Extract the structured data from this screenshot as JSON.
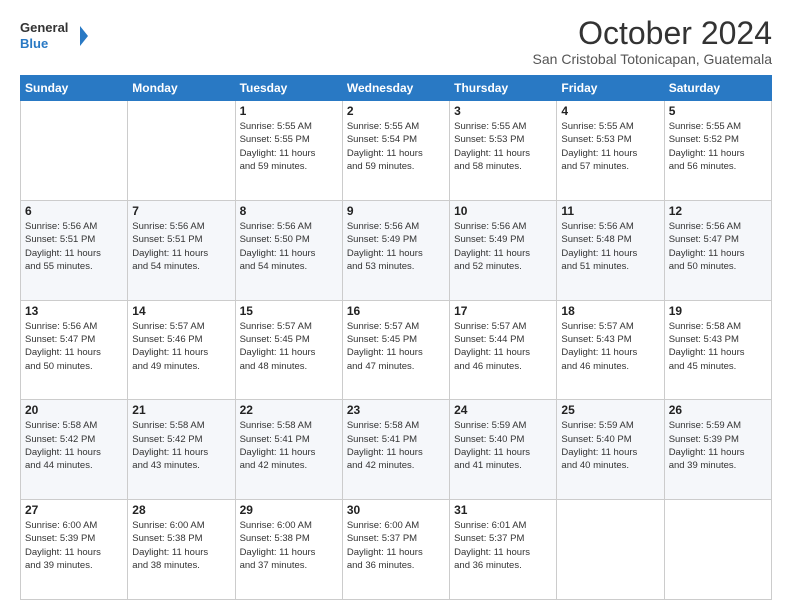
{
  "logo": {
    "line1": "General",
    "line2": "Blue"
  },
  "header": {
    "month": "October 2024",
    "location": "San Cristobal Totonicapan, Guatemala"
  },
  "weekdays": [
    "Sunday",
    "Monday",
    "Tuesday",
    "Wednesday",
    "Thursday",
    "Friday",
    "Saturday"
  ],
  "weeks": [
    [
      {
        "day": "",
        "info": ""
      },
      {
        "day": "",
        "info": ""
      },
      {
        "day": "1",
        "info": "Sunrise: 5:55 AM\nSunset: 5:55 PM\nDaylight: 11 hours\nand 59 minutes."
      },
      {
        "day": "2",
        "info": "Sunrise: 5:55 AM\nSunset: 5:54 PM\nDaylight: 11 hours\nand 59 minutes."
      },
      {
        "day": "3",
        "info": "Sunrise: 5:55 AM\nSunset: 5:53 PM\nDaylight: 11 hours\nand 58 minutes."
      },
      {
        "day": "4",
        "info": "Sunrise: 5:55 AM\nSunset: 5:53 PM\nDaylight: 11 hours\nand 57 minutes."
      },
      {
        "day": "5",
        "info": "Sunrise: 5:55 AM\nSunset: 5:52 PM\nDaylight: 11 hours\nand 56 minutes."
      }
    ],
    [
      {
        "day": "6",
        "info": "Sunrise: 5:56 AM\nSunset: 5:51 PM\nDaylight: 11 hours\nand 55 minutes."
      },
      {
        "day": "7",
        "info": "Sunrise: 5:56 AM\nSunset: 5:51 PM\nDaylight: 11 hours\nand 54 minutes."
      },
      {
        "day": "8",
        "info": "Sunrise: 5:56 AM\nSunset: 5:50 PM\nDaylight: 11 hours\nand 54 minutes."
      },
      {
        "day": "9",
        "info": "Sunrise: 5:56 AM\nSunset: 5:49 PM\nDaylight: 11 hours\nand 53 minutes."
      },
      {
        "day": "10",
        "info": "Sunrise: 5:56 AM\nSunset: 5:49 PM\nDaylight: 11 hours\nand 52 minutes."
      },
      {
        "day": "11",
        "info": "Sunrise: 5:56 AM\nSunset: 5:48 PM\nDaylight: 11 hours\nand 51 minutes."
      },
      {
        "day": "12",
        "info": "Sunrise: 5:56 AM\nSunset: 5:47 PM\nDaylight: 11 hours\nand 50 minutes."
      }
    ],
    [
      {
        "day": "13",
        "info": "Sunrise: 5:56 AM\nSunset: 5:47 PM\nDaylight: 11 hours\nand 50 minutes."
      },
      {
        "day": "14",
        "info": "Sunrise: 5:57 AM\nSunset: 5:46 PM\nDaylight: 11 hours\nand 49 minutes."
      },
      {
        "day": "15",
        "info": "Sunrise: 5:57 AM\nSunset: 5:45 PM\nDaylight: 11 hours\nand 48 minutes."
      },
      {
        "day": "16",
        "info": "Sunrise: 5:57 AM\nSunset: 5:45 PM\nDaylight: 11 hours\nand 47 minutes."
      },
      {
        "day": "17",
        "info": "Sunrise: 5:57 AM\nSunset: 5:44 PM\nDaylight: 11 hours\nand 46 minutes."
      },
      {
        "day": "18",
        "info": "Sunrise: 5:57 AM\nSunset: 5:43 PM\nDaylight: 11 hours\nand 46 minutes."
      },
      {
        "day": "19",
        "info": "Sunrise: 5:58 AM\nSunset: 5:43 PM\nDaylight: 11 hours\nand 45 minutes."
      }
    ],
    [
      {
        "day": "20",
        "info": "Sunrise: 5:58 AM\nSunset: 5:42 PM\nDaylight: 11 hours\nand 44 minutes."
      },
      {
        "day": "21",
        "info": "Sunrise: 5:58 AM\nSunset: 5:42 PM\nDaylight: 11 hours\nand 43 minutes."
      },
      {
        "day": "22",
        "info": "Sunrise: 5:58 AM\nSunset: 5:41 PM\nDaylight: 11 hours\nand 42 minutes."
      },
      {
        "day": "23",
        "info": "Sunrise: 5:58 AM\nSunset: 5:41 PM\nDaylight: 11 hours\nand 42 minutes."
      },
      {
        "day": "24",
        "info": "Sunrise: 5:59 AM\nSunset: 5:40 PM\nDaylight: 11 hours\nand 41 minutes."
      },
      {
        "day": "25",
        "info": "Sunrise: 5:59 AM\nSunset: 5:40 PM\nDaylight: 11 hours\nand 40 minutes."
      },
      {
        "day": "26",
        "info": "Sunrise: 5:59 AM\nSunset: 5:39 PM\nDaylight: 11 hours\nand 39 minutes."
      }
    ],
    [
      {
        "day": "27",
        "info": "Sunrise: 6:00 AM\nSunset: 5:39 PM\nDaylight: 11 hours\nand 39 minutes."
      },
      {
        "day": "28",
        "info": "Sunrise: 6:00 AM\nSunset: 5:38 PM\nDaylight: 11 hours\nand 38 minutes."
      },
      {
        "day": "29",
        "info": "Sunrise: 6:00 AM\nSunset: 5:38 PM\nDaylight: 11 hours\nand 37 minutes."
      },
      {
        "day": "30",
        "info": "Sunrise: 6:00 AM\nSunset: 5:37 PM\nDaylight: 11 hours\nand 36 minutes."
      },
      {
        "day": "31",
        "info": "Sunrise: 6:01 AM\nSunset: 5:37 PM\nDaylight: 11 hours\nand 36 minutes."
      },
      {
        "day": "",
        "info": ""
      },
      {
        "day": "",
        "info": ""
      }
    ]
  ]
}
